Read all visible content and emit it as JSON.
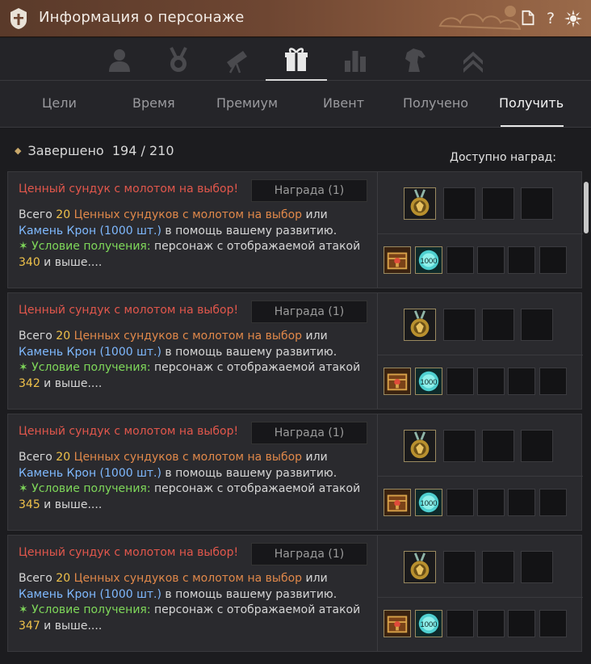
{
  "window": {
    "title": "Информация о персонаже"
  },
  "icon_tabs": [
    {
      "name": "character-icon"
    },
    {
      "name": "medal-icon"
    },
    {
      "name": "telescope-icon"
    },
    {
      "name": "gift-icon",
      "active": true
    },
    {
      "name": "bar-chart-icon"
    },
    {
      "name": "horse-icon"
    },
    {
      "name": "chevrons-up-icon"
    }
  ],
  "tabs": [
    {
      "label": "Цели"
    },
    {
      "label": "Время"
    },
    {
      "label": "Премиум"
    },
    {
      "label": "Ивент"
    },
    {
      "label": "Получено"
    },
    {
      "label": "Получить",
      "active": true
    }
  ],
  "summary": {
    "completed_label": "Завершено",
    "completed_value": "194 / 210",
    "available_label": "Доступно наград:"
  },
  "cards": [
    {
      "name": "Ценный сундук с молотом на выбор!",
      "button": "Награда (1)",
      "line1_a": "Всего ",
      "line1_num": "20",
      "line1_item": " Ценных сундуков с молотом на выбор",
      "line1_b": " или",
      "line2_item": "Камень Крон (1000 шт.)",
      "line2_b": " в помощь вашему развитию.",
      "cond_label": "✶ Условие получения:",
      "cond_text": " персонаж с отображаемой атакой",
      "cond_value": "340",
      "cond_tail": " и выше...."
    },
    {
      "name": "Ценный сундук с молотом на выбор!",
      "button": "Награда (1)",
      "line1_a": "Всего ",
      "line1_num": "20",
      "line1_item": " Ценных сундуков с молотом на выбор",
      "line1_b": " или",
      "line2_item": "Камень Крон (1000 шт.)",
      "line2_b": " в помощь вашему развитию.",
      "cond_label": "✶ Условие получения:",
      "cond_text": " персонаж с отображаемой атакой",
      "cond_value": "342",
      "cond_tail": " и выше...."
    },
    {
      "name": "Ценный сундук с молотом на выбор!",
      "button": "Награда (1)",
      "line1_a": "Всего ",
      "line1_num": "20",
      "line1_item": " Ценных сундуков с молотом на выбор",
      "line1_b": " или",
      "line2_item": "Камень Крон (1000 шт.)",
      "line2_b": " в помощь вашему развитию.",
      "cond_label": "✶ Условие получения:",
      "cond_text": " персонаж с отображаемой атакой",
      "cond_value": "345",
      "cond_tail": " и выше...."
    },
    {
      "name": "Ценный сундук с молотом на выбор!",
      "button": "Награда (1)",
      "line1_a": "Всего ",
      "line1_num": "20",
      "line1_item": " Ценных сундуков с молотом на выбор",
      "line1_b": " или",
      "line2_item": "Камень Крон (1000 шт.)",
      "line2_b": " в помощь вашему развитию.",
      "cond_label": "✶ Условие получения:",
      "cond_text": " персонаж с отображаемой атакой",
      "cond_value": "347",
      "cond_tail": " и выше...."
    }
  ],
  "stone_count": "1000",
  "colors": {
    "item_name": "#e2574c",
    "highlight_yellow": "#f0c24a",
    "item_orange": "#e0884a",
    "item_blue": "#7fb9ff",
    "condition_green": "#7fd85a",
    "titlebar": "#6e4632"
  }
}
